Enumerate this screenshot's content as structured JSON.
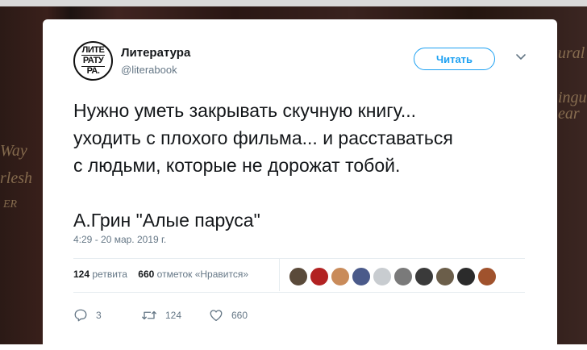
{
  "account": {
    "name": "Литература",
    "handle": "@literabook",
    "avatar_lines": [
      "ЛИТЕ",
      "РАТУ",
      "РА."
    ]
  },
  "follow_button": {
    "label": "Читать"
  },
  "tweet": {
    "lines": [
      "Нужно уметь закрывать скучную книгу...",
      "уходить с плохого фильма... и расставаться",
      "с людьми, которые не дорожат тобой.",
      "",
      "А.Грин \"Алые паруса\""
    ],
    "timestamp": "4:29 - 20 мар. 2019 г."
  },
  "stats": {
    "retweets_count": "124",
    "retweets_label": "ретвита",
    "likes_count": "660",
    "likes_label": "отметок «Нравится»"
  },
  "liker_avatar_colors": [
    "#5a4a3a",
    "#b22222",
    "#c98b5a",
    "#4a5a8a",
    "#c8ccd0",
    "#7a7a7a",
    "#3a3a3a",
    "#6b5e4a",
    "#2b2b2b",
    "#a0522d"
  ],
  "actions": {
    "reply_count": "3",
    "retweet_count": "124",
    "like_count": "660"
  },
  "background_text": [
    "Way",
    "rlesh",
    "ER",
    "ural",
    "ingue",
    "ear"
  ],
  "colors": {
    "accent": "#1da1f2",
    "text": "#14171a",
    "muted": "#657786"
  }
}
